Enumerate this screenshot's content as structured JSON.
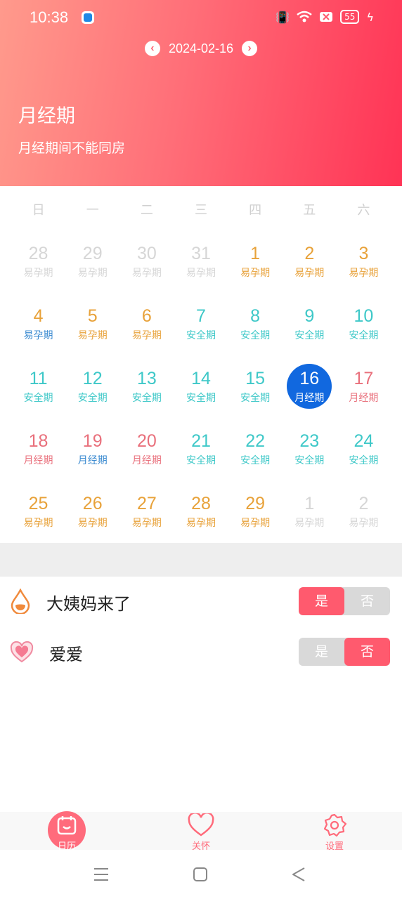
{
  "status": {
    "time": "10:38",
    "battery": "55"
  },
  "header": {
    "date": "2024-02-16",
    "phase_title": "月经期",
    "phase_desc": "月经期间不能同房"
  },
  "weekdays": [
    "日",
    "一",
    "二",
    "三",
    "四",
    "五",
    "六"
  ],
  "calendar": [
    {
      "n": "28",
      "l": "易孕期",
      "c": "#d6d6d6"
    },
    {
      "n": "29",
      "l": "易孕期",
      "c": "#d6d6d6"
    },
    {
      "n": "30",
      "l": "易孕期",
      "c": "#d6d6d6"
    },
    {
      "n": "31",
      "l": "易孕期",
      "c": "#d6d6d6"
    },
    {
      "n": "1",
      "l": "易孕期",
      "c": "#e8a23a"
    },
    {
      "n": "2",
      "l": "易孕期",
      "c": "#e8a23a"
    },
    {
      "n": "3",
      "l": "易孕期",
      "c": "#e8a23a"
    },
    {
      "n": "4",
      "l": "易孕期",
      "c": "#e8a23a",
      "lc": "#3a8ad0"
    },
    {
      "n": "5",
      "l": "易孕期",
      "c": "#e8a23a"
    },
    {
      "n": "6",
      "l": "易孕期",
      "c": "#e8a23a"
    },
    {
      "n": "7",
      "l": "安全期",
      "c": "#3ec8c8"
    },
    {
      "n": "8",
      "l": "安全期",
      "c": "#3ec8c8"
    },
    {
      "n": "9",
      "l": "安全期",
      "c": "#3ec8c8"
    },
    {
      "n": "10",
      "l": "安全期",
      "c": "#3ec8c8"
    },
    {
      "n": "11",
      "l": "安全期",
      "c": "#3ec8c8"
    },
    {
      "n": "12",
      "l": "安全期",
      "c": "#3ec8c8"
    },
    {
      "n": "13",
      "l": "安全期",
      "c": "#3ec8c8"
    },
    {
      "n": "14",
      "l": "安全期",
      "c": "#3ec8c8"
    },
    {
      "n": "15",
      "l": "安全期",
      "c": "#3ec8c8"
    },
    {
      "n": "16",
      "l": "月经期",
      "c": "#ffffff",
      "sel": true
    },
    {
      "n": "17",
      "l": "月经期",
      "c": "#e9707c"
    },
    {
      "n": "18",
      "l": "月经期",
      "c": "#e9707c"
    },
    {
      "n": "19",
      "l": "月经期",
      "c": "#e9707c",
      "lc": "#3a8ad0"
    },
    {
      "n": "20",
      "l": "月经期",
      "c": "#e9707c"
    },
    {
      "n": "21",
      "l": "安全期",
      "c": "#3ec8c8"
    },
    {
      "n": "22",
      "l": "安全期",
      "c": "#3ec8c8"
    },
    {
      "n": "23",
      "l": "安全期",
      "c": "#3ec8c8"
    },
    {
      "n": "24",
      "l": "安全期",
      "c": "#3ec8c8"
    },
    {
      "n": "25",
      "l": "易孕期",
      "c": "#e8a23a"
    },
    {
      "n": "26",
      "l": "易孕期",
      "c": "#e8a23a"
    },
    {
      "n": "27",
      "l": "易孕期",
      "c": "#e8a23a"
    },
    {
      "n": "28",
      "l": "易孕期",
      "c": "#e8a23a"
    },
    {
      "n": "29",
      "l": "易孕期",
      "c": "#e8a23a"
    },
    {
      "n": "1",
      "l": "易孕期",
      "c": "#d6d6d6"
    },
    {
      "n": "2",
      "l": "易孕期",
      "c": "#d6d6d6"
    }
  ],
  "records": {
    "period": {
      "label": "大姨妈来了",
      "yes": "是",
      "no": "否",
      "value": "yes"
    },
    "love": {
      "label": "爱爱",
      "yes": "是",
      "no": "否",
      "value": "no"
    }
  },
  "tabs": {
    "calendar": "日历",
    "care": "关怀",
    "settings": "设置"
  }
}
